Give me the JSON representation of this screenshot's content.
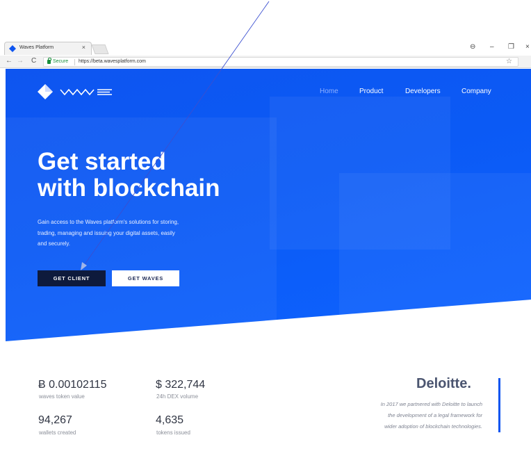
{
  "browser": {
    "tab_title": "Waves Platform",
    "tab_close": "×",
    "secure_label": "Secure",
    "url": "https://beta.wavesplatform.com",
    "nav_back": "←",
    "nav_forward": "→",
    "nav_reload": "C",
    "bookmark_star": "☆",
    "win_account": "⊖",
    "win_minimize": "–",
    "win_restore": "❐",
    "win_close": "×"
  },
  "nav": {
    "items": [
      {
        "label": "Home"
      },
      {
        "label": "Product"
      },
      {
        "label": "Developers"
      },
      {
        "label": "Company"
      }
    ]
  },
  "hero": {
    "headline_line1": "Get started",
    "headline_line2": "with blockchain",
    "subtext_line1": "Gain access to the Waves platform's solutions for storing,",
    "subtext_line2": "trading, managing and issuing your digital assets, easily",
    "subtext_line3": "and securely.",
    "primary_button": "GET CLIENT",
    "secondary_button": "GET WAVES"
  },
  "stats": [
    {
      "value": "Ƀ 0.00102115",
      "label": "waves token value"
    },
    {
      "value": "$ 322,744",
      "label": "24h DEX volume"
    },
    {
      "value": "94,267",
      "label": "wallets created"
    },
    {
      "value": "4,635",
      "label": "tokens issued"
    }
  ],
  "partner": {
    "name": "Deloitte.",
    "text_line1": "In 2017 we partnered with Deloitte to launch",
    "text_line2": "the development of a legal framework for",
    "text_line3": "wider adoption of blockchain technologies."
  },
  "colors": {
    "hero_blue": "#0e55f0",
    "dark_button": "#0e1a3c",
    "annotation_line": "#3a4fd0"
  },
  "icons": {
    "favicon": "waves-diamond-icon",
    "logo": "waves-logo-icon",
    "lock": "lock-icon",
    "star": "star-icon"
  }
}
